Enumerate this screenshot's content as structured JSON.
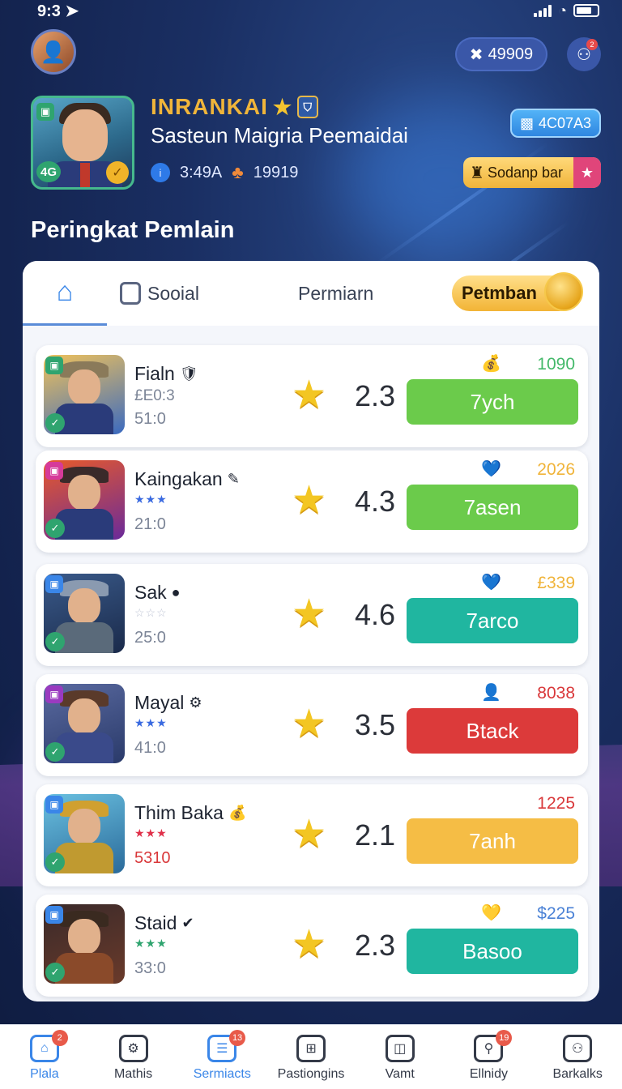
{
  "status": {
    "time": "9:3"
  },
  "header": {
    "coins": "49909",
    "friend_badge": "2"
  },
  "profile": {
    "level": "4G",
    "name": "INRANKAI",
    "title": "Sastеun Maigria Peemaidai",
    "stat1": "3:49A",
    "stat2": "19919",
    "gems": "4C07A3",
    "shop_label": "Sodanp bar"
  },
  "section_title": "Peringkat Pemlain",
  "tabs": {
    "social": "Sooial",
    "premium": "Permiarn",
    "pill": "Petmban"
  },
  "rows": [
    {
      "name": "Fialn",
      "sub1": "£E0:3",
      "sub2": "51:0",
      "score": "2.3",
      "top_value": "1090",
      "top_color": "#44b96a",
      "top_icon": "bag",
      "action": "7ych",
      "action_color": "#6bcb4b"
    },
    {
      "name": "Kaingakan",
      "sub1": "★★★",
      "sub2": "21:0",
      "score": "4.3",
      "top_value": "2026",
      "top_color": "#f0b43a",
      "top_icon": "heart-blue",
      "action": "7asen",
      "action_color": "#6bcb4b"
    },
    {
      "name": "Sak",
      "sub1": "☆☆☆",
      "sub2": "25:0",
      "score": "4.6",
      "top_value": "£339",
      "top_color": "#f0b43a",
      "top_icon": "heart-blue",
      "action": "7arco",
      "action_color": "#20b6a0"
    },
    {
      "name": "Mayal",
      "sub1": "★★★",
      "sub2": "41:0",
      "score": "3.5",
      "top_value": "8038",
      "top_color": "#d9383a",
      "top_icon": "person",
      "action": "Btack",
      "action_color": "#dc3a3a"
    },
    {
      "name": "Thim Baka",
      "sub1": "★★★",
      "sub2": "5310",
      "score": "2.1",
      "top_value": "1225",
      "top_color": "#d9383a",
      "top_icon": "heart-red",
      "action": "7anh",
      "action_color": "#f5bd45"
    },
    {
      "name": "Staid",
      "sub1": "★★★",
      "sub2": "33:0",
      "score": "2.3",
      "top_value": "$225",
      "top_color": "#4b82d6",
      "top_icon": "heart-gold",
      "action": "Basoo",
      "action_color": "#20b6a0"
    }
  ],
  "nav": [
    {
      "label": "Plala",
      "badge": "2",
      "active": true
    },
    {
      "label": "Mathis",
      "badge": "",
      "active": false
    },
    {
      "label": "Sermiacts",
      "badge": "13",
      "active": true
    },
    {
      "label": "Pastiongins",
      "badge": "",
      "active": false
    },
    {
      "label": "Vamt",
      "badge": "",
      "active": false
    },
    {
      "label": "Ellnidy",
      "badge": "19",
      "active": false
    },
    {
      "label": "Barkalks",
      "badge": "",
      "active": false
    }
  ]
}
